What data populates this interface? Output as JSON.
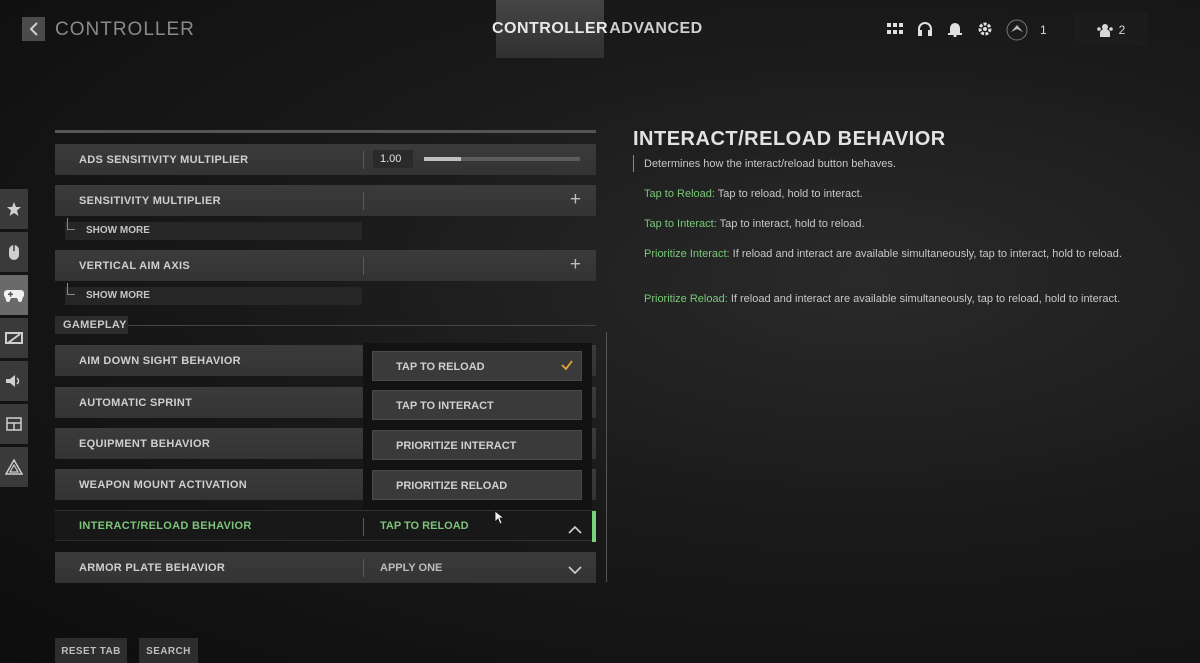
{
  "header": {
    "title": "CONTROLLER",
    "tabs": [
      {
        "label": "CONTROLLER",
        "active": true
      },
      {
        "label": "ADVANCED",
        "active": false
      }
    ],
    "icons": [
      "grid-icon",
      "headset-icon",
      "bell-icon",
      "gear-icon"
    ],
    "rank_count": "1",
    "party_count": "2"
  },
  "sidenav": [
    "star-icon",
    "mouse-icon",
    "gamepad-icon",
    "display-icon",
    "speaker-icon",
    "interface-icon",
    "network-icon"
  ],
  "settings": {
    "ads_sensitivity": {
      "label": "ADS SENSITIVITY MULTIPLIER",
      "value": "1.00",
      "level": 0.24
    },
    "sensitivity_multiplier": {
      "label": "SENSITIVITY MULTIPLIER"
    },
    "show_more_1": "SHOW MORE",
    "vertical_aim": {
      "label": "VERTICAL AIM AXIS"
    },
    "show_more_2": "SHOW MORE",
    "section": "GAMEPLAY",
    "aim_down_sight": {
      "label": "AIM DOWN SIGHT BEHAVIOR"
    },
    "automatic_sprint": {
      "label": "AUTOMATIC SPRINT"
    },
    "equipment": {
      "label": "EQUIPMENT BEHAVIOR"
    },
    "weapon_mount": {
      "label": "WEAPON MOUNT ACTIVATION"
    },
    "interact_reload": {
      "label": "INTERACT/RELOAD BEHAVIOR",
      "value": "TAP TO RELOAD"
    },
    "armor_plate": {
      "label": "ARMOR PLATE BEHAVIOR",
      "value": "APPLY ONE"
    }
  },
  "dropdown": {
    "options": [
      "TAP TO RELOAD",
      "TAP TO INTERACT",
      "PRIORITIZE INTERACT",
      "PRIORITIZE RELOAD"
    ],
    "selected": "TAP TO RELOAD"
  },
  "description": {
    "title": "INTERACT/RELOAD BEHAVIOR",
    "intro": "Determines how the interact/reload button behaves.",
    "items": [
      {
        "term": "Tap to Reload:",
        "text": " Tap to reload, hold to interact."
      },
      {
        "term": "Tap to Interact:",
        "text": " Tap to interact, hold to reload."
      },
      {
        "term": "Prioritize Interact:",
        "text": " If reload and interact are available simultaneously, tap to interact, hold to reload."
      },
      {
        "term": "Prioritize Reload:",
        "text": " If reload and interact are available simultaneously, tap to reload, hold to interact."
      }
    ]
  },
  "footer": {
    "reset_tab": "RESET TAB",
    "search": "SEARCH"
  },
  "colors": {
    "accent_green": "#7cc47a",
    "check_orange": "#e8a33a"
  }
}
